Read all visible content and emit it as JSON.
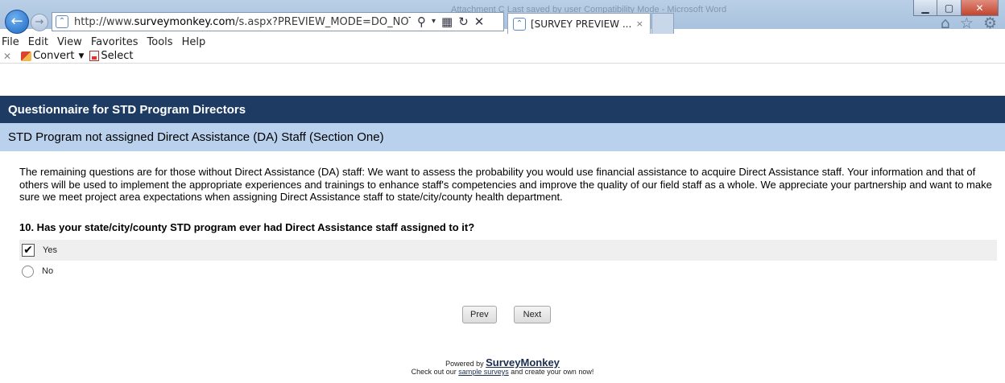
{
  "browser": {
    "window_title": "Attachment C Last saved by user Compatibility Mode - Microsoft Word",
    "url_prefix": "http://www.",
    "url_domain": "surveymonkey.com",
    "url_rest": "/s.aspx?PREVIEW_MODE=DO_NOT",
    "tab_title": "[SURVEY PREVIEW ...",
    "tab_close": "×",
    "menu": [
      "File",
      "Edit",
      "View",
      "Favorites",
      "Tools",
      "Help"
    ],
    "toolbar": {
      "convert_label": "Convert",
      "select_label": "Select"
    },
    "icons": [
      "back-icon",
      "forward-icon",
      "search-icon",
      "compatibility-icon",
      "refresh-icon",
      "stop-icon",
      "home-icon",
      "favorites-star-icon",
      "settings-gear-icon"
    ]
  },
  "survey": {
    "title": "Questionnaire for STD Program Directors",
    "section": "STD Program not assigned Direct Assistance (DA) Staff (Section One)",
    "intro": "The remaining questions are for those without Direct Assistance (DA) staff: We want to assess the probability you would use financial assistance to acquire Direct Assistance staff. Your information and that of others will be used to implement the appropriate experiences and trainings to enhance staff's competencies and improve the quality of our field staff as a whole. We appreciate your partnership and want to make sure we meet project area expectations when assigning Direct Assistance staff to state/city/county health department.",
    "question": "10. Has your state/city/county STD program ever had Direct Assistance staff assigned to it?",
    "options": [
      {
        "label": "Yes",
        "selected": true
      },
      {
        "label": "No",
        "selected": false
      }
    ],
    "prev_label": "Prev",
    "next_label": "Next"
  },
  "footer": {
    "powered_by": "Powered by",
    "brand": "SurveyMonkey",
    "line2_pre": "Check out our",
    "line2_link": "sample surveys",
    "line2_post": "and create your own now!"
  },
  "colors": {
    "header_bg": "#1d3b63",
    "section_bg": "#b9d1ec",
    "selected_row_bg": "#efefef"
  }
}
